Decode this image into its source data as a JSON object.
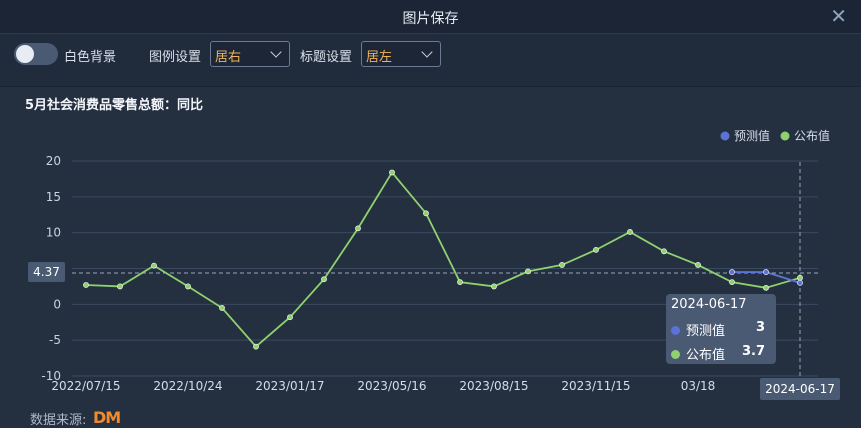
{
  "window": {
    "title": "图片保存"
  },
  "toolbar": {
    "toggle_label": "白色背景",
    "legend_setting_label": "图例设置",
    "legend_setting_value": "居右",
    "title_setting_label": "标题设置",
    "title_setting_value": "居左"
  },
  "footer": {
    "source_label": "数据来源:",
    "logo_text": "DM"
  },
  "tooltip": {
    "date": "2024-06-17",
    "rows": [
      {
        "name": "预测值",
        "value": "3",
        "color": "#5b73d6"
      },
      {
        "name": "公布值",
        "value": "3.7",
        "color": "#8fd16e"
      }
    ]
  },
  "crosshair": {
    "y_value": "4.37",
    "x_value": "2024-06-17"
  },
  "colors": {
    "forecast": "#5b73d6",
    "published": "#8fd16e"
  },
  "chart_data": {
    "type": "line",
    "title": "5月社会消费品零售总额：同比",
    "legend": [
      "预测值",
      "公布值"
    ],
    "legend_position": "top-right",
    "ylim": [
      -10,
      20
    ],
    "yticks": [
      20,
      15,
      10,
      5,
      0,
      -5,
      -10
    ],
    "xtick_labels": [
      "2022/07/15",
      "2022/10/24",
      "2023/01/17",
      "2023/05/16",
      "2023/08/15",
      "2023/11/15",
      "03/18"
    ],
    "grid": true,
    "series": [
      {
        "name": "公布值",
        "values": [
          2.7,
          2.5,
          5.4,
          2.5,
          -0.5,
          -5.9,
          -1.8,
          3.5,
          10.6,
          18.4,
          12.7,
          3.1,
          2.5,
          4.6,
          5.5,
          7.6,
          10.1,
          7.4,
          5.5,
          3.1,
          2.3,
          3.7
        ]
      },
      {
        "name": "预测值",
        "values": [
          null,
          null,
          null,
          null,
          null,
          null,
          null,
          null,
          null,
          null,
          null,
          null,
          null,
          null,
          null,
          null,
          null,
          null,
          null,
          4.5,
          4.5,
          3.0
        ]
      }
    ]
  }
}
